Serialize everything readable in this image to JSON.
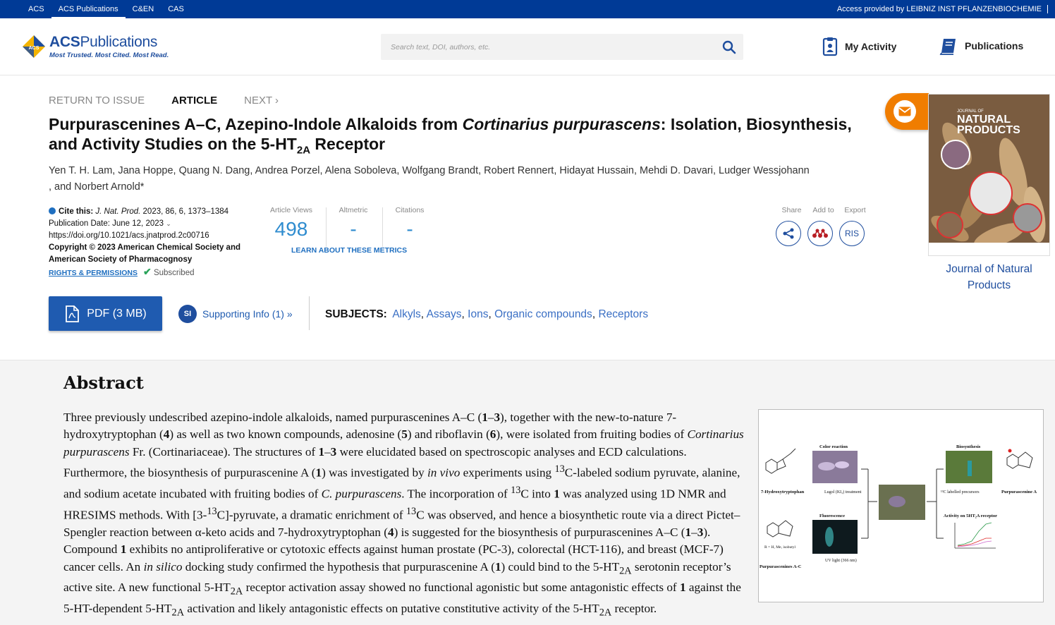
{
  "topbar": {
    "links": [
      "ACS",
      "ACS Publications",
      "C&EN",
      "CAS"
    ],
    "access": "Access provided by LEIBNIZ INST PFLANZENBIOCHEMIE"
  },
  "header": {
    "logo_brand_a": "ACS",
    "logo_brand_b": "Publications",
    "logo_tagline": "Most Trusted. Most Cited. Most Read.",
    "search_placeholder": "Search text, DOI, authors, etc.",
    "my_activity": "My Activity",
    "publications": "Publications"
  },
  "nav": {
    "return": "RETURN TO ISSUE",
    "article": "ARTICLE",
    "next": "NEXT ›"
  },
  "article": {
    "title_part1": "Purpurascenines A–C, Azepino-Indole Alkaloids from ",
    "title_italic": "Cortinarius purpurascens",
    "title_part2": ": Isolation, Biosynthesis, and Activity Studies on the 5-HT",
    "title_sub": "2A",
    "title_part3": " Receptor",
    "authors_line1": "Yen T. H. Lam, Jana Hoppe, Quang N. Dang, Andrea Porzel, Alena Soboleva, Wolfgang Brandt, Robert Rennert, Hidayat Hussain, Mehdi D. Davari, Ludger Wessjohann",
    "authors_line2": ", and Norbert Arnold*"
  },
  "cite": {
    "label": "Cite this:",
    "journal": "J. Nat. Prod.",
    "ref": " 2023, 86, 6, 1373–1384",
    "pubdate": "Publication Date: June 12, 2023",
    "doi": "https://doi.org/10.1021/acs.jnatprod.2c00716",
    "copyright": "Copyright © 2023 American Chemical Society and American Society of Pharmacognosy",
    "rights": "RIGHTS & PERMISSIONS",
    "subscribed": "Subscribed"
  },
  "metrics": {
    "views_label": "Article Views",
    "views_value": "498",
    "altmetric_label": "Altmetric",
    "altmetric_value": "-",
    "citations_label": "Citations",
    "citations_value": "-",
    "learn": "LEARN ABOUT THESE METRICS"
  },
  "share": {
    "share_label": "Share",
    "add_label": "Add to",
    "export_label": "Export",
    "ris": "RIS"
  },
  "actions": {
    "pdf": "PDF (3 MB)",
    "si_badge": "SI",
    "si": "Supporting Info (1) »",
    "subjects_label": "SUBJECTS:",
    "subjects": [
      "Alkyls",
      "Assays",
      "Ions",
      "Organic compounds",
      "Receptors"
    ]
  },
  "cover": {
    "journal_small": "JOURNAL OF",
    "journal_big1": "NATURAL",
    "journal_big2": "PRODUCTS",
    "caption": "Journal of Natural Products"
  },
  "abstract": {
    "heading": "Abstract"
  },
  "toc": {
    "color_reaction": "Color reaction",
    "biosynthesis": "Biosynthesis",
    "hydroxytryptophan": "7-Hydroxytryptophan",
    "lugol": "Lugol (KI₃) treatment",
    "labelled": "¹³C labelled precursors",
    "purpurascenine_a": "Purpurascenine A",
    "fluorescence": "Fluorescence",
    "activity": "Activity on 5HT₂A receptor",
    "r_label": "R = H, Me, isobutyl",
    "purpurascenines": "Purpurascenines A-C",
    "uv": "UV light (366 nm)"
  },
  "colors": {
    "topbar": "#003a96",
    "brand": "#1f4e9e",
    "link": "#3a6fc4",
    "metric": "#2f8ccf",
    "mail": "#f07d00"
  }
}
